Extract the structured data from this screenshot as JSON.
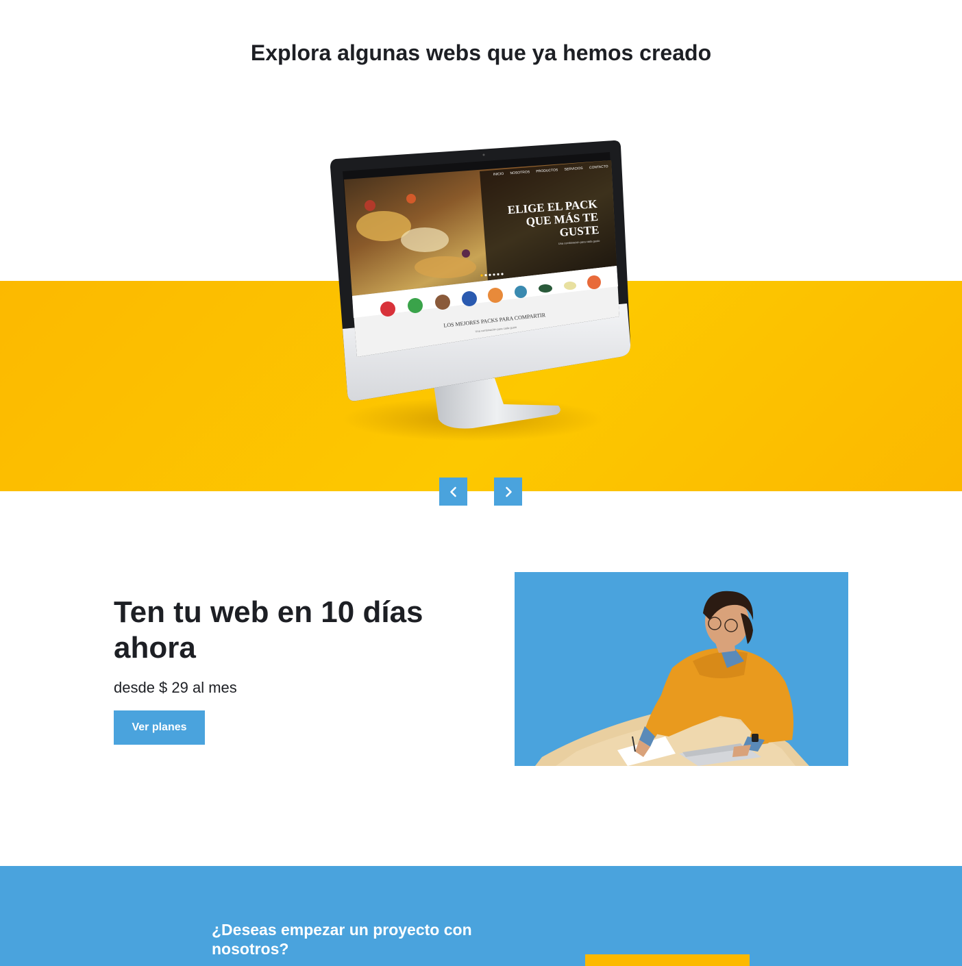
{
  "portfolio": {
    "title": "Explora algunas webs que ya hemos creado",
    "screen": {
      "headline": [
        "ELIGE EL PACK",
        "QUE MÁS TE",
        "GUSTE"
      ],
      "subheadline": "Una combinación para cada gusto",
      "nav": [
        "INICIO",
        "NOSOTROS",
        "PRODUCTOS",
        "SERVICIOS",
        "CONTACTO"
      ],
      "section_title": "LOS MEJORES PACKS PARA COMPARTIR",
      "section_sub": "Una combinación para cada gusto"
    },
    "prev_icon": "chevron-left-icon",
    "next_icon": "chevron-right-icon"
  },
  "promo": {
    "title": "Ten tu web en 10 días ahora",
    "price": "desde $ 29 al mes",
    "button_label": "Ver planes"
  },
  "cta": {
    "title": "¿Deseas empezar un proyecto con nosotros?"
  },
  "colors": {
    "accent_blue": "#4aa3dd",
    "accent_yellow": "#fcb900",
    "text_dark": "#1d1f24"
  }
}
